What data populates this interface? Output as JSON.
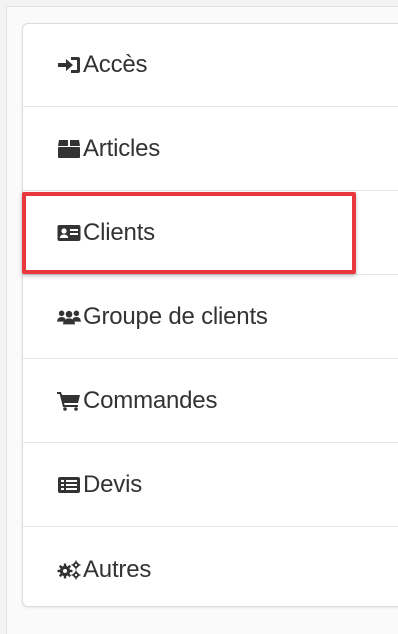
{
  "menu": {
    "items": [
      {
        "label": "Accès",
        "icon": "sign-in-icon"
      },
      {
        "label": "Articles",
        "icon": "archive-box-icon"
      },
      {
        "label": "Clients",
        "icon": "id-card-icon"
      },
      {
        "label": "Groupe de clients",
        "icon": "users-icon"
      },
      {
        "label": "Commandes",
        "icon": "shopping-cart-icon"
      },
      {
        "label": "Devis",
        "icon": "list-alt-icon"
      },
      {
        "label": "Autres",
        "icon": "gears-icon"
      }
    ],
    "highlighted_item": "Clients"
  },
  "colors": {
    "highlight_border": "#e8383d",
    "text": "#333333",
    "icon": "#333333",
    "divider": "#e6e6e6"
  }
}
